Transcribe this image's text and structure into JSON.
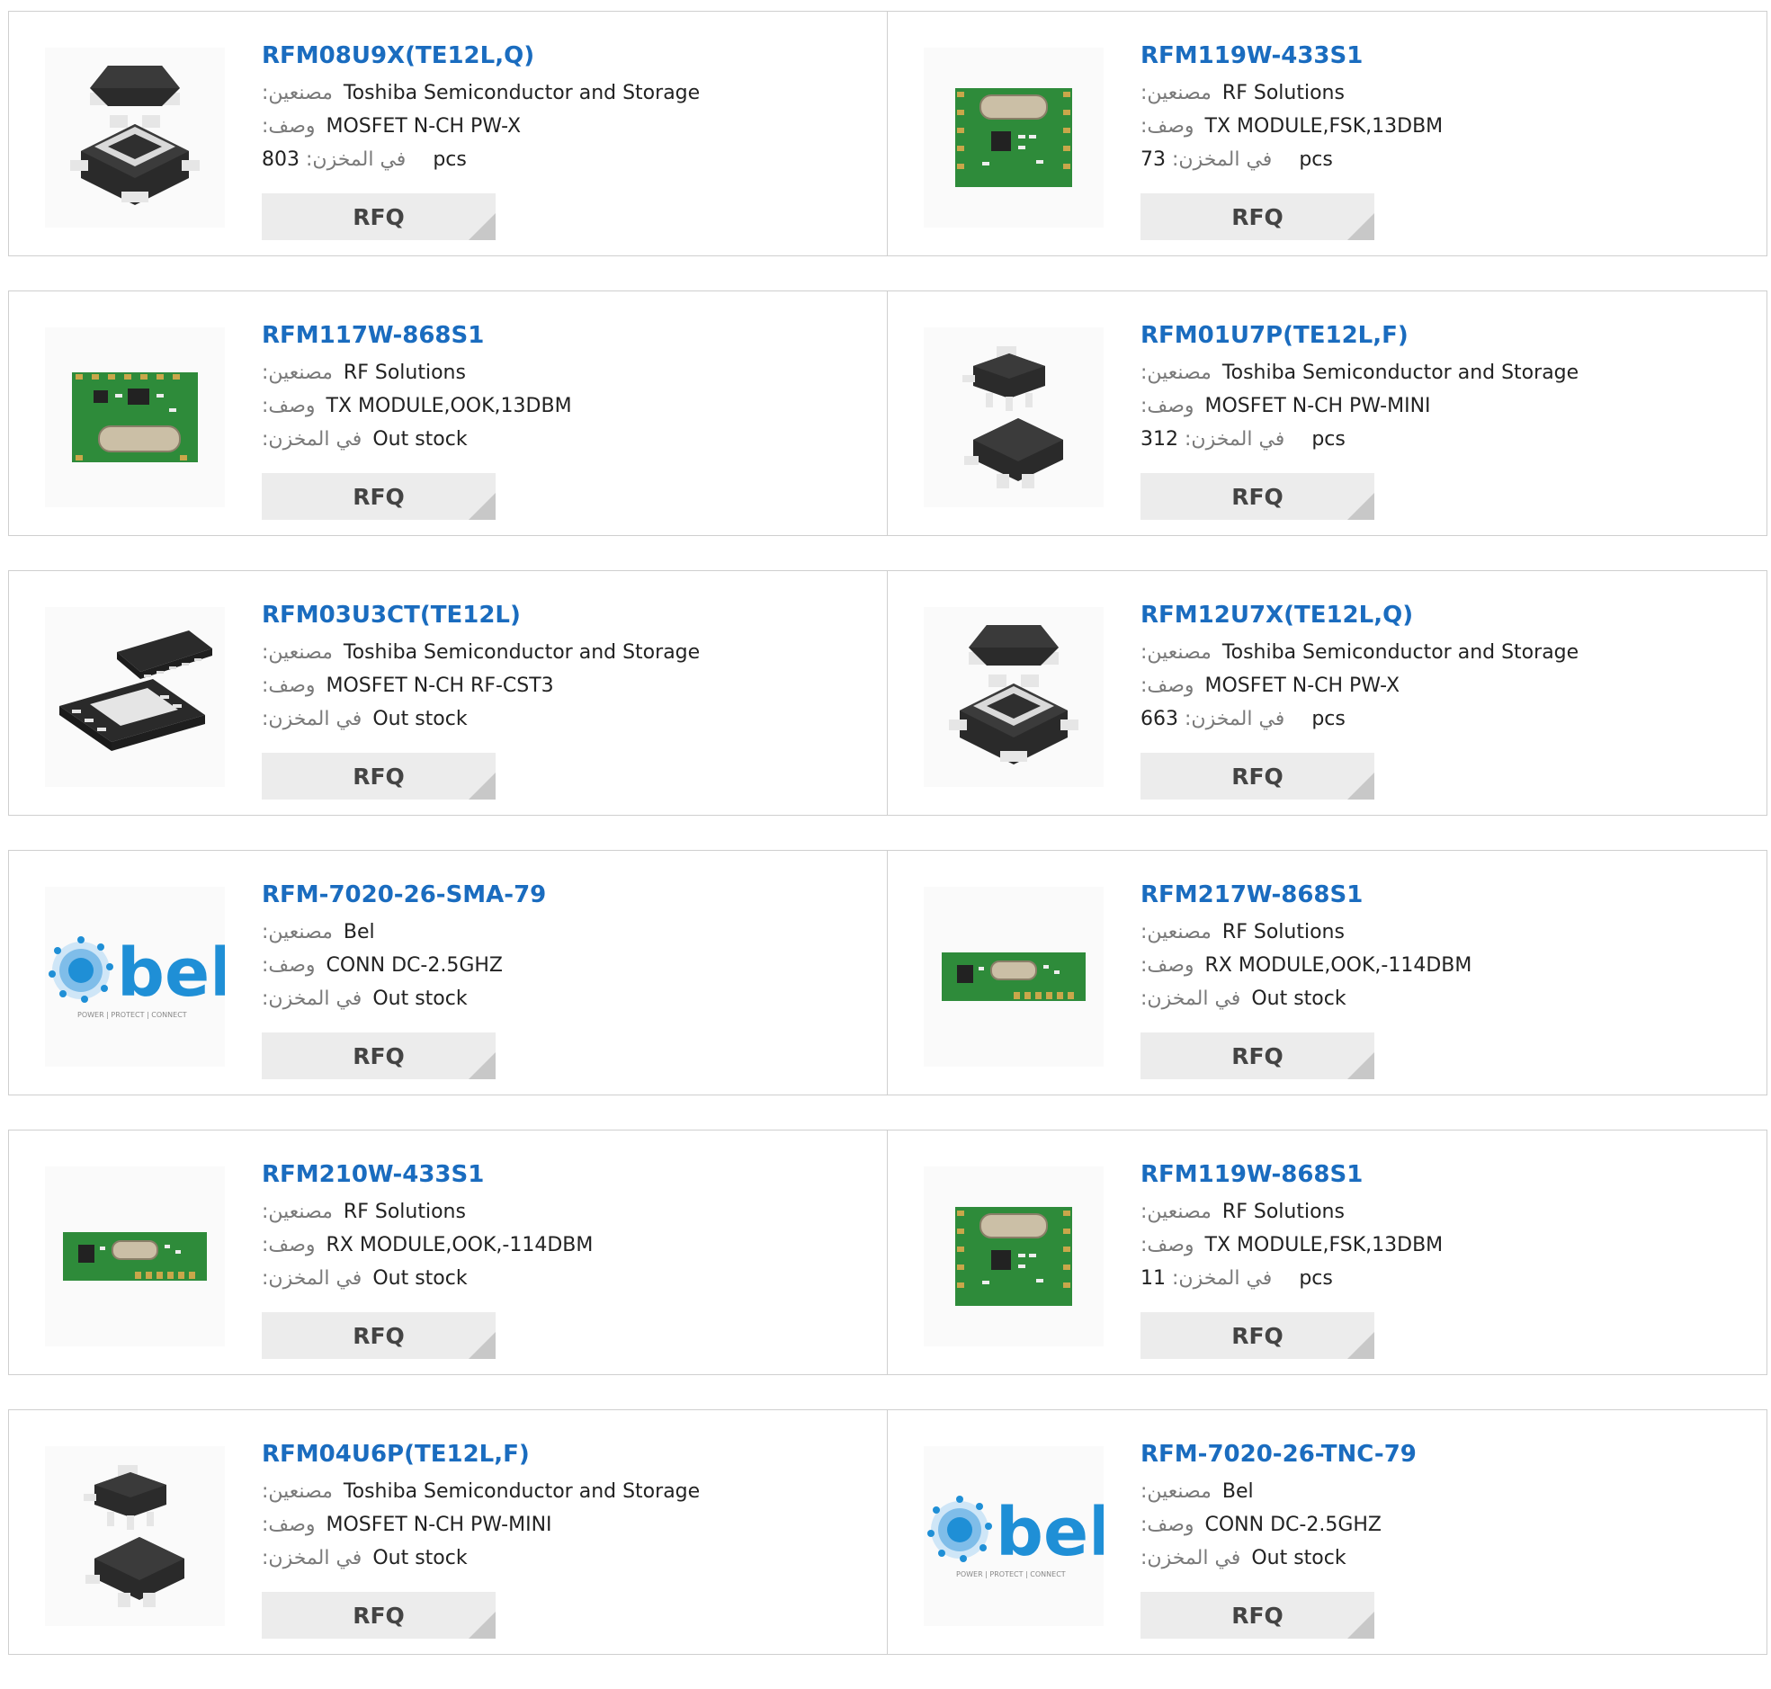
{
  "labels": {
    "manufacturer": ":مصنعين",
    "description": ":وصف",
    "stock": ":في المخزن",
    "unit": "pcs",
    "rfq": "RFQ"
  },
  "products": [
    {
      "part": "RFM08U9X(TE12L,Q)",
      "manufacturer": "Toshiba Semiconductor and Storage",
      "description": "MOSFET N-CH PW-X",
      "stock": "803",
      "in_stock": true,
      "image": "sot-x-package"
    },
    {
      "part": "RFM119W-433S1",
      "manufacturer": "RF Solutions",
      "description": "TX MODULE,FSK,13DBM",
      "stock": "73",
      "in_stock": true,
      "image": "rf-module-square"
    },
    {
      "part": "RFM117W-868S1",
      "manufacturer": "RF Solutions",
      "description": "TX MODULE,OOK,13DBM",
      "stock": "Out stock",
      "in_stock": false,
      "image": "rf-module-wide"
    },
    {
      "part": "RFM01U7P(TE12L,F)",
      "manufacturer": "Toshiba Semiconductor and Storage",
      "description": "MOSFET N-CH PW-MINI",
      "stock": "312",
      "in_stock": true,
      "image": "sot89-package"
    },
    {
      "part": "RFM03U3CT(TE12L)",
      "manufacturer": "Toshiba Semiconductor and Storage",
      "description": "MOSFET N-CH RF-CST3",
      "stock": "Out stock",
      "in_stock": false,
      "image": "cst3-package"
    },
    {
      "part": "RFM12U7X(TE12L,Q)",
      "manufacturer": "Toshiba Semiconductor and Storage",
      "description": "MOSFET N-CH PW-X",
      "stock": "663",
      "in_stock": true,
      "image": "sot-x-package"
    },
    {
      "part": "RFM-7020-26-SMA-79",
      "manufacturer": "Bel",
      "description": "CONN DC-2.5GHZ",
      "stock": "Out stock",
      "in_stock": false,
      "image": "bel-logo"
    },
    {
      "part": "RFM217W-868S1",
      "manufacturer": "RF Solutions",
      "description": "RX MODULE,OOK,-114DBM",
      "stock": "Out stock",
      "in_stock": false,
      "image": "rf-module-strip"
    },
    {
      "part": "RFM210W-433S1",
      "manufacturer": "RF Solutions",
      "description": "RX MODULE,OOK,-114DBM",
      "stock": "Out stock",
      "in_stock": false,
      "image": "rf-module-strip"
    },
    {
      "part": "RFM119W-868S1",
      "manufacturer": "RF Solutions",
      "description": "TX MODULE,FSK,13DBM",
      "stock": "11",
      "in_stock": true,
      "image": "rf-module-square"
    },
    {
      "part": "RFM04U6P(TE12L,F)",
      "manufacturer": "Toshiba Semiconductor and Storage",
      "description": "MOSFET N-CH PW-MINI",
      "stock": "Out stock",
      "in_stock": false,
      "image": "sot89-package"
    },
    {
      "part": "RFM-7020-26-TNC-79",
      "manufacturer": "Bel",
      "description": "CONN DC-2.5GHZ",
      "stock": "Out stock",
      "in_stock": false,
      "image": "bel-logo"
    }
  ],
  "bel_logo": {
    "wordmark": "bel",
    "tagline": "POWER | PROTECT | CONNECT"
  },
  "colors": {
    "link": "#1a6cbf",
    "pcb_green": "#2e8b3a",
    "bel_blue": "#1f8fd6",
    "rfq_bg": "#ececec"
  }
}
